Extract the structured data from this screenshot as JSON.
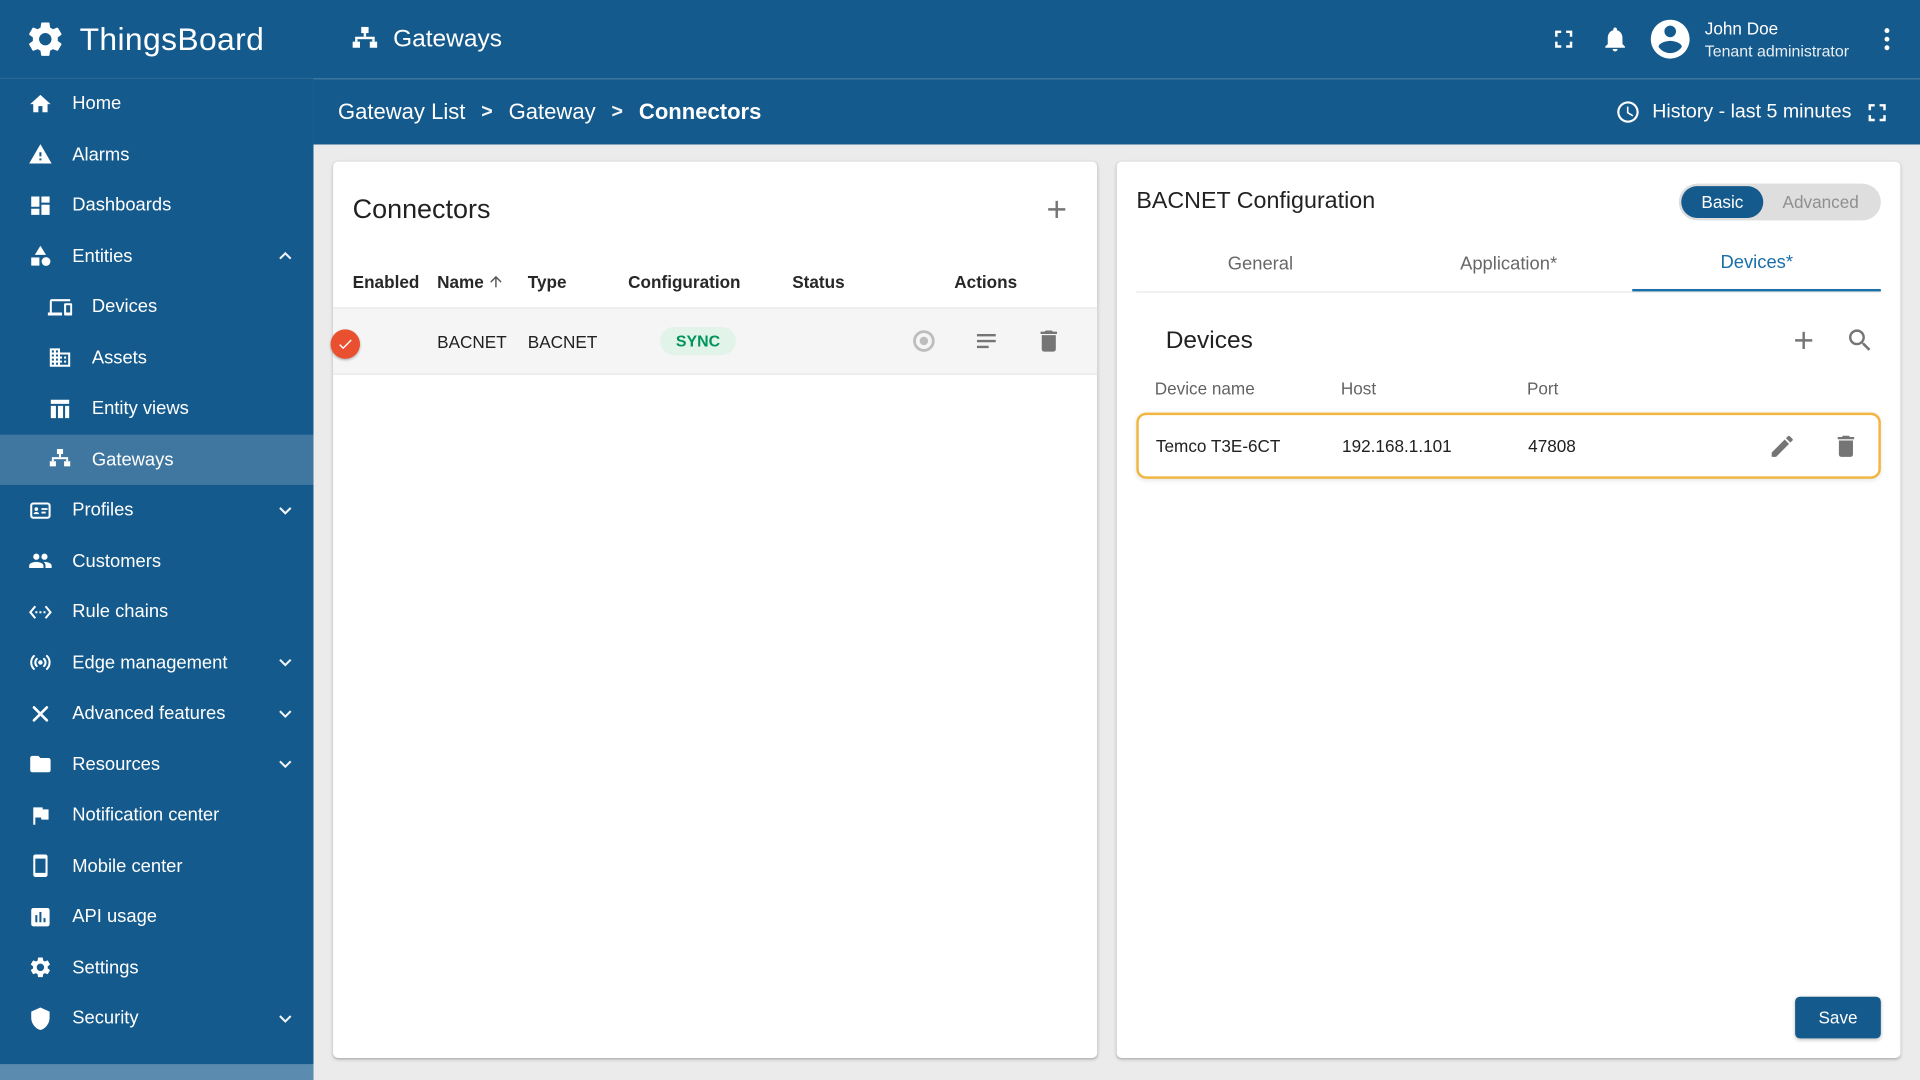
{
  "colors": {
    "primary": "#155a8c",
    "sidebar_selected": "rgba(255,255,255,0.18)",
    "toggle_on": "#e8502f",
    "toggle_track": "#f29b82",
    "chip_bg": "#e2f4ea",
    "chip_text": "#00945c",
    "status_ok": "#1a9e38",
    "row_highlight_border": "#f2b53d",
    "tab_active": "#1a6fa8"
  },
  "topbar": {
    "brand": "ThingsBoard",
    "page_title": "Gateways",
    "user_name": "John Doe",
    "user_role": "Tenant administrator"
  },
  "breadcrumb": {
    "separator": ">",
    "items": [
      "Gateway List",
      "Gateway",
      "Connectors"
    ],
    "history_label": "History - last 5 minutes"
  },
  "sidebar": {
    "items": [
      {
        "label": "Home",
        "icon": "home-icon"
      },
      {
        "label": "Alarms",
        "icon": "warning-icon"
      },
      {
        "label": "Dashboards",
        "icon": "dashboard-icon"
      },
      {
        "label": "Entities",
        "icon": "entities-icon",
        "expanded": true
      },
      {
        "label": "Devices",
        "icon": "devices-icon",
        "child": true
      },
      {
        "label": "Assets",
        "icon": "building-icon",
        "child": true
      },
      {
        "label": "Entity views",
        "icon": "table-icon",
        "child": true
      },
      {
        "label": "Gateways",
        "icon": "lan-icon",
        "child": true,
        "selected": true
      },
      {
        "label": "Profiles",
        "icon": "badge-icon",
        "collapsed": true
      },
      {
        "label": "Customers",
        "icon": "people-icon"
      },
      {
        "label": "Rule chains",
        "icon": "ethernet-icon"
      },
      {
        "label": "Edge management",
        "icon": "antenna-icon",
        "collapsed": true
      },
      {
        "label": "Advanced features",
        "icon": "tools-icon",
        "collapsed": true
      },
      {
        "label": "Resources",
        "icon": "folder-icon",
        "collapsed": true
      },
      {
        "label": "Notification center",
        "icon": "flag-icon"
      },
      {
        "label": "Mobile center",
        "icon": "smartphone-icon"
      },
      {
        "label": "API usage",
        "icon": "chart-icon"
      },
      {
        "label": "Settings",
        "icon": "gear-icon"
      },
      {
        "label": "Security",
        "icon": "shield-icon",
        "collapsed": true
      }
    ]
  },
  "connectors": {
    "title": "Connectors",
    "columns": {
      "enabled": "Enabled",
      "name": "Name",
      "type": "Type",
      "configuration": "Configuration",
      "status": "Status",
      "actions": "Actions"
    },
    "row": {
      "enabled": true,
      "name": "BACNET",
      "type": "BACNET",
      "configuration": "SYNC"
    }
  },
  "config": {
    "title": "BACNET Configuration",
    "toggle": {
      "basic": "Basic",
      "advanced": "Advanced",
      "selected": "Basic"
    },
    "tabs": {
      "general": "General",
      "application": "Application*",
      "devices": "Devices*",
      "active": "Devices*"
    },
    "devices": {
      "title": "Devices",
      "columns": {
        "name": "Device name",
        "host": "Host",
        "port": "Port"
      },
      "row": {
        "name": "Temco T3E-6CT",
        "host": "192.168.1.101",
        "port": "47808"
      }
    },
    "save": "Save"
  }
}
